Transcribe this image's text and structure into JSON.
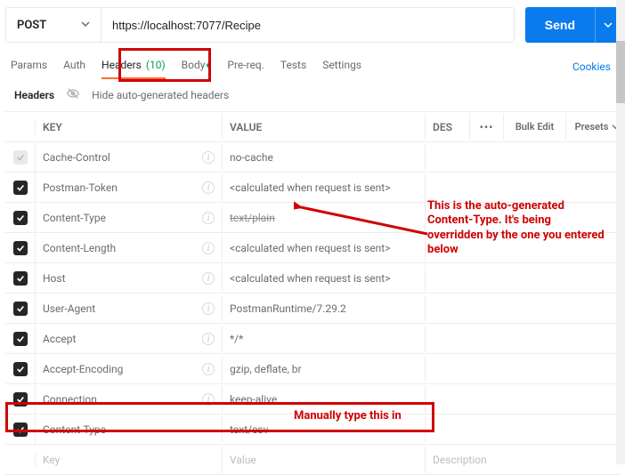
{
  "request": {
    "method": "POST",
    "url": "https://localhost:7077/Recipe",
    "send_label": "Send"
  },
  "tabs": {
    "params": "Params",
    "auth": "Auth",
    "headers": "Headers",
    "headers_count": "(10)",
    "body": "Body",
    "prereq": "Pre-req.",
    "tests": "Tests",
    "settings": "Settings",
    "cookies": "Cookies"
  },
  "subheader": {
    "title": "Headers",
    "hide_label": "Hide auto-generated headers"
  },
  "columns": {
    "key": "KEY",
    "value": "VALUE",
    "desc": "DES",
    "bulk": "Bulk Edit",
    "presets": "Presets"
  },
  "rows": [
    {
      "checked": false,
      "key": "Cache-Control",
      "value": "no-cache",
      "auto": true
    },
    {
      "checked": true,
      "key": "Postman-Token",
      "value": "<calculated when request is sent>",
      "auto": true
    },
    {
      "checked": true,
      "key": "Content-Type",
      "value": "text/plain",
      "auto": true,
      "struck": true
    },
    {
      "checked": true,
      "key": "Content-Length",
      "value": "<calculated when request is sent>",
      "auto": true
    },
    {
      "checked": true,
      "key": "Host",
      "value": "<calculated when request is sent>",
      "auto": true
    },
    {
      "checked": true,
      "key": "User-Agent",
      "value": "PostmanRuntime/7.29.2",
      "auto": true
    },
    {
      "checked": true,
      "key": "Accept",
      "value": "*/*",
      "auto": true
    },
    {
      "checked": true,
      "key": "Accept-Encoding",
      "value": "gzip, deflate, br",
      "auto": true
    },
    {
      "checked": true,
      "key": "Connection",
      "value": "keep-alive",
      "auto": true
    },
    {
      "checked": true,
      "key": "Content-Type",
      "value": "text/csv",
      "auto": false
    }
  ],
  "placeholder_row": {
    "key": "Key",
    "value": "Value",
    "desc": "Description"
  },
  "annotations": {
    "override_text": "This is the auto-generated Content-Type. It's being overridden by the one you entered below",
    "manual_text": "Manually type this in"
  }
}
